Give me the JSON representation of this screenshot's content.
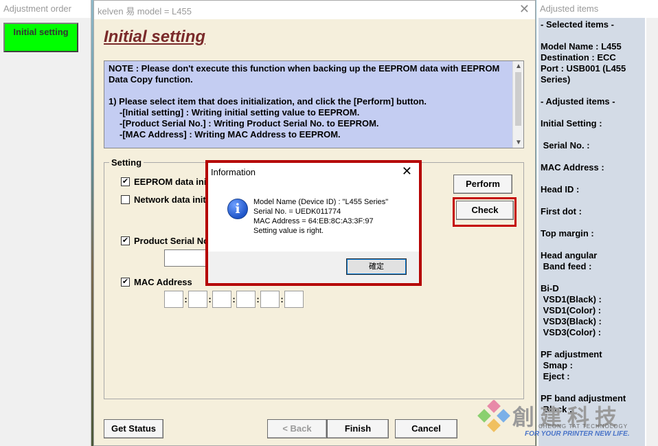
{
  "left_window": {
    "title": "Adjustment order",
    "button_label": "Initial setting"
  },
  "main_window": {
    "title": "kelven   易   model = L455",
    "heading": "Initial setting",
    "note": {
      "line1": "NOTE : Please don't execute this function when backing up the EEPROM data with EEPROM",
      "line2": "Data Copy function.",
      "line3": "1) Please select item that does initialization, and click the [Perform] button.",
      "line4": "-[Initial setting] : Writing initial setting value to EEPROM.",
      "line5": "-[Product Serial No.] : Writing Product Serial No. to EEPROM.",
      "line6": "-[MAC Address] : Writing MAC Address to EEPROM."
    },
    "setting_label": "Setting",
    "checks": [
      {
        "label": "EEPROM data ini",
        "checked": true
      },
      {
        "label": "Network data init",
        "checked": false
      },
      {
        "label": "Product Serial No",
        "checked": true
      },
      {
        "label": "MAC Address",
        "checked": true
      }
    ],
    "check_marks": {
      "on": "✔",
      "off": ""
    },
    "buttons": {
      "perform": "Perform",
      "check": "Check",
      "get_status": "Get Status",
      "back": "< Back",
      "finish": "Finish",
      "cancel": "Cancel"
    }
  },
  "dialog": {
    "title": "Information",
    "lines": [
      "Model Name (Device ID) : \"L455 Series\"",
      "Serial No. = UEDK011774",
      "MAC Address = 64:EB:8C:A3:3F:97",
      "Setting value is right."
    ],
    "ok_label": "確定"
  },
  "right_window": {
    "title": "Adjusted items",
    "lines": [
      "- Selected items -",
      "",
      "Model Name : L455",
      "Destination : ECC",
      "Port : USB001 (L455",
      "Series)",
      "",
      "- Adjusted items -",
      "",
      "Initial Setting :",
      "",
      " Serial No. :",
      "",
      "MAC Address :",
      "",
      "Head ID :",
      "",
      "First dot :",
      "",
      "Top margin :",
      "",
      "Head angular",
      " Band feed :",
      "",
      "Bi-D",
      " VSD1(Black) :",
      " VSD1(Color) :",
      " VSD3(Black) :",
      " VSD3(Color) :",
      "",
      "PF adjustment",
      " Smap :",
      " Eject :",
      "",
      "PF band adjustment",
      " Black :"
    ]
  },
  "watermark": {
    "brand": "創建科技",
    "sub": "CHEONG TAT TECHNOLOGY",
    "slogan": "FOR YOUR PRINTER NEW LIFE."
  }
}
